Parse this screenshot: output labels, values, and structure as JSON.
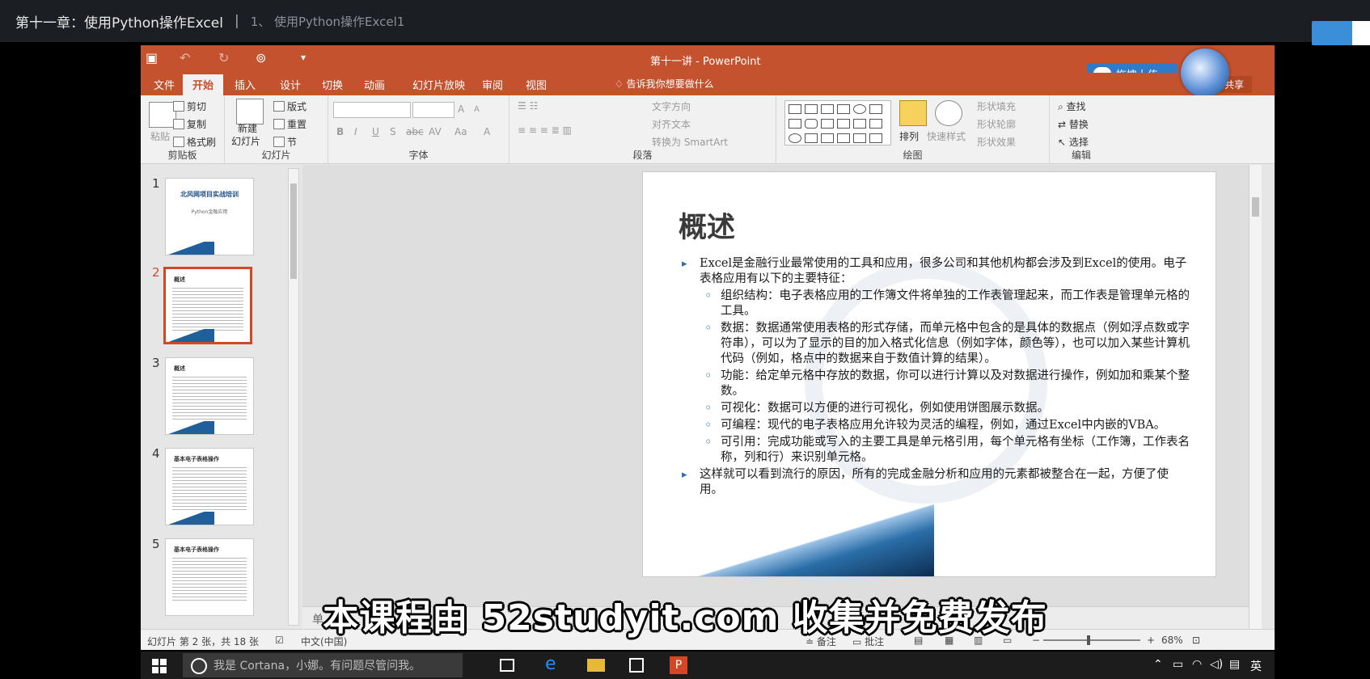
{
  "video": {
    "chapter_title": "第十一章：使用Python操作Excel",
    "separator": "|",
    "lesson_title": "1、 使用Python操作Excel1"
  },
  "window": {
    "title": "第十一讲 - PowerPoint",
    "upload_label": "拖拽上传",
    "share_label": "共享"
  },
  "tabs": [
    "文件",
    "开始",
    "插入",
    "设计",
    "切换",
    "动画",
    "幻灯片放映",
    "审阅",
    "视图"
  ],
  "active_tab": "开始",
  "tell_me": "告诉我你想要做什么",
  "ribbon": {
    "clipboard": {
      "label": "剪贴板",
      "paste": "粘贴",
      "cut": "剪切",
      "copy": "复制",
      "format_painter": "格式刷"
    },
    "slides": {
      "label": "幻灯片",
      "new_slide": "新建",
      "new_slide2": "幻灯片",
      "layout": "版式",
      "reset": "重置",
      "section": "节"
    },
    "font": {
      "label": "字体",
      "bold": "B",
      "italic": "I",
      "underline": "U",
      "shadow": "S",
      "strike": "abc",
      "spacing": "AV",
      "case": "Aa",
      "color": "A",
      "grow": "A",
      "shrink": "A"
    },
    "paragraph": {
      "label": "段落",
      "text_direction": "文字方向",
      "align_text": "对齐文本",
      "smartart": "转换为 SmartArt"
    },
    "drawing": {
      "label": "绘图",
      "arrange": "排列",
      "quick_styles": "快速样式",
      "shape_fill": "形状填充",
      "shape_outline": "形状轮廓",
      "shape_effects": "形状效果"
    },
    "editing": {
      "label": "编辑",
      "find": "查找",
      "replace": "替换",
      "select": "选择"
    }
  },
  "thumbnails": [
    {
      "num": "1",
      "title": "北风网项目实战培训",
      "subtitle": "Python金融应用"
    },
    {
      "num": "2",
      "title": "概述"
    },
    {
      "num": "3",
      "title": "概述"
    },
    {
      "num": "4",
      "title": "基本电子表格操作"
    },
    {
      "num": "5",
      "title": "基本电子表格操作"
    }
  ],
  "slide": {
    "title": "概述",
    "intro": "Excel是金融行业最常使用的工具和应用，很多公司和其他机构都会涉及到Excel的使用。电子表格应用有以下的主要特征：",
    "points": [
      "组织结构：电子表格应用的工作簿文件将单独的工作表管理起来，而工作表是管理单元格的工具。",
      "数据：数据通常使用表格的形式存储，而单元格中包含的是具体的数据点（例如浮点数或字符串），可以为了显示的目的加入格式化信息（例如字体，颜色等），也可以加入某些计算机代码（例如，格点中的数据来自于数值计算的结果）。",
      "功能：给定单元格中存放的数据，你可以进行计算以及对数据进行操作，例如加和乘某个整数。",
      "可视化：数据可以方便的进行可视化，例如使用饼图展示数据。",
      "可编程：现代的电子表格应用允许较为灵活的编程，例如，通过Excel中内嵌的VBA。",
      "可引用：完成功能或写入的主要工具是单元格引用，每个单元格有坐标（工作簿，工作表名称，列和行）来识别单元格。"
    ],
    "conclusion": "这样就可以看到流行的原因，所有的完成金融分析和应用的元素都被整合在一起，方便了使用。"
  },
  "notes_partial": "单",
  "status": {
    "slide_info": "幻灯片 第 2 张，共 18 张",
    "language": "中文(中国)",
    "notes": "备注",
    "comments": "批注",
    "zoom": "68%"
  },
  "subtitle": "本课程由 52studyit.com 收集并免费发布",
  "taskbar": {
    "cortana_placeholder": "我是 Cortana，小娜。有问题尽管问我。",
    "ime": "英"
  }
}
